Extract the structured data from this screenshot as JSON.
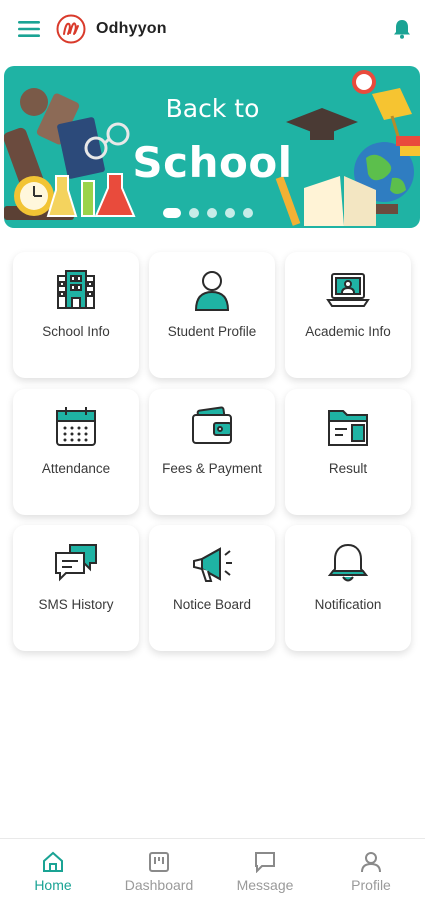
{
  "app": {
    "title": "Odhyyon",
    "accent_color": "#1aa394",
    "icons": {
      "menu": "menu-icon",
      "logo": "app-logo",
      "notifications": "bell-icon"
    }
  },
  "banner": {
    "line1": "Back to",
    "line2": "School",
    "background": "#1fb3a4",
    "slides_count": 5,
    "active_slide": 1
  },
  "grid": [
    {
      "label": "School Info",
      "icon": "school-building-icon"
    },
    {
      "label": "Student Profile",
      "icon": "student-icon"
    },
    {
      "label": "Academic Info",
      "icon": "laptop-profile-icon"
    },
    {
      "label": "Attendance",
      "icon": "calendar-icon"
    },
    {
      "label": "Fees & Payment",
      "icon": "wallet-icon"
    },
    {
      "label": "Result",
      "icon": "folder-result-icon"
    },
    {
      "label": "SMS History",
      "icon": "chat-bubbles-icon"
    },
    {
      "label": "Notice Board",
      "icon": "megaphone-icon"
    },
    {
      "label": "Notification",
      "icon": "bell-outline-icon"
    }
  ],
  "bottom_nav": [
    {
      "label": "Home",
      "icon": "home-icon",
      "active": true
    },
    {
      "label": "Dashboard",
      "icon": "dashboard-icon",
      "active": false
    },
    {
      "label": "Message",
      "icon": "message-icon",
      "active": false
    },
    {
      "label": "Profile",
      "icon": "profile-icon",
      "active": false
    }
  ]
}
